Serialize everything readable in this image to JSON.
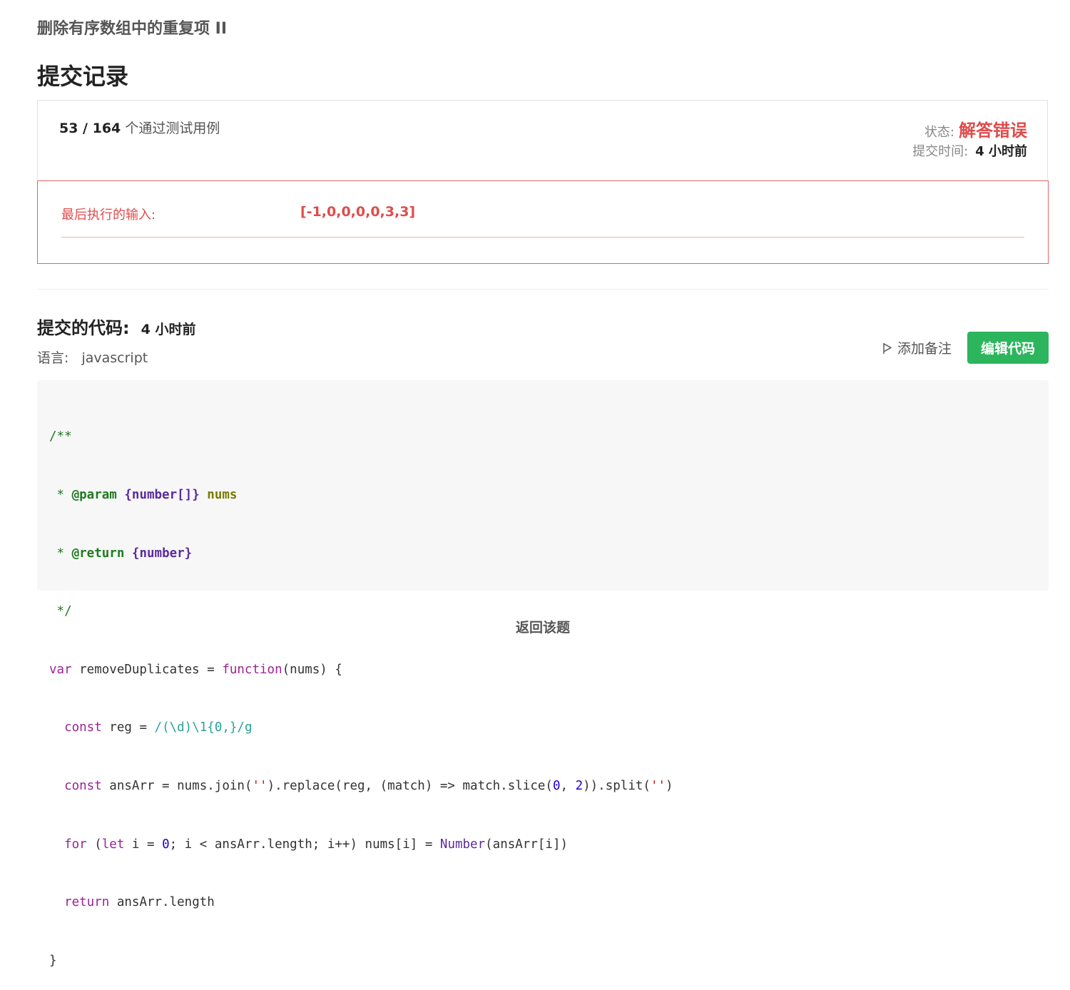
{
  "problem_title": "删除有序数组中的重复项 II",
  "page_heading": "提交记录",
  "summary": {
    "cases_passed": "53 / 164",
    "cases_text": "个通过测试用例",
    "status_label": "状态:",
    "status_value": "解答错误",
    "time_label": "提交时间:",
    "time_value": "4 小时前"
  },
  "last_input": {
    "label": "最后执行的输入:",
    "value": "[-1,0,0,0,0,3,3]"
  },
  "code_section": {
    "heading": "提交的代码:",
    "time": "4 小时前",
    "language_label": "语言:",
    "language": "javascript",
    "add_note_label": "添加备注",
    "edit_button_label": "编辑代码"
  },
  "code_lines": [
    "/**",
    " * @param {number[]} nums",
    " * @return {number}",
    " */",
    "var removeDuplicates = function(nums) {",
    "  const reg = /(\\d)\\1{0,}/g",
    "  const ansArr = nums.join('').replace(reg, (match) => match.slice(0, 2)).split('')",
    "  for (let i = 0; i < ansArr.length; i++) nums[i] = Number(ansArr[i])",
    "  return ansArr.length",
    "}"
  ],
  "back_link": "返回该题",
  "colors": {
    "error": "#e04b4b",
    "accent_green": "#2db55d",
    "code_bg": "#f7f7f7"
  }
}
